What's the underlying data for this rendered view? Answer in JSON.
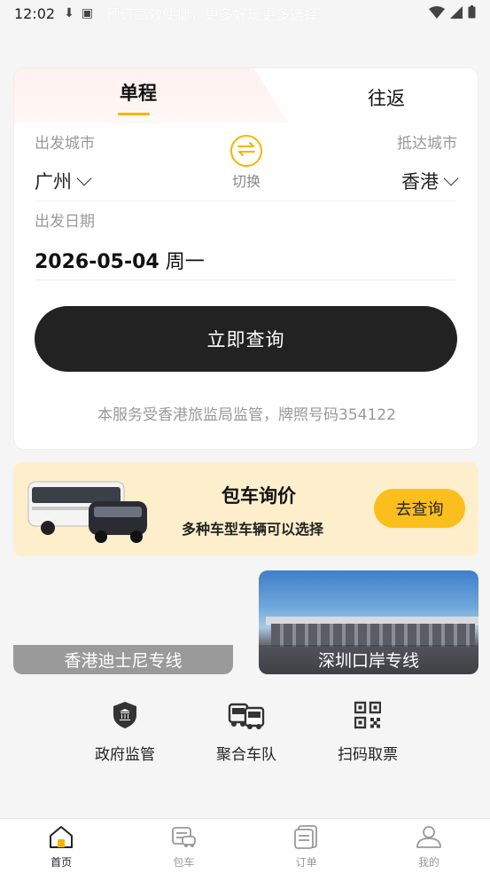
{
  "status_bar": {
    "time": "12:02",
    "marquee": "预订高效便捷，更多好玩更多选择"
  },
  "booking": {
    "tabs": [
      {
        "label": "单程",
        "active": true
      },
      {
        "label": "往返",
        "active": false
      }
    ],
    "departure_label": "出发城市",
    "departure_city": "广州",
    "arrival_label": "抵达城市",
    "arrival_city": "香港",
    "swap_label": "切换",
    "date_label": "出发日期",
    "date_value": "2026-05-04",
    "weekday": "周一",
    "query_button": "立即查询",
    "license_text": "本服务受香港旅监局监管，牌照号码354122"
  },
  "charter": {
    "title": "包车询价",
    "subtitle": "多种车型车辆可以选择",
    "button": "去查询"
  },
  "routes": [
    {
      "label": "香港迪士尼专线"
    },
    {
      "label": "深圳口岸专线"
    }
  ],
  "features": [
    {
      "label": "政府监管",
      "icon": "shield-icon"
    },
    {
      "label": "聚合车队",
      "icon": "bus-fleet-icon"
    },
    {
      "label": "扫码取票",
      "icon": "qr-code-icon"
    }
  ],
  "bottom_nav": [
    {
      "label": "首页",
      "icon": "home-icon",
      "active": true
    },
    {
      "label": "包车",
      "icon": "car-icon",
      "active": false
    },
    {
      "label": "订单",
      "icon": "order-icon",
      "active": false
    },
    {
      "label": "我的",
      "icon": "profile-icon",
      "active": false
    }
  ],
  "colors": {
    "accent": "#f6b400",
    "button_dark": "#222222",
    "charter_bg": "#fdefcc",
    "charter_button": "#fbbf1d"
  }
}
